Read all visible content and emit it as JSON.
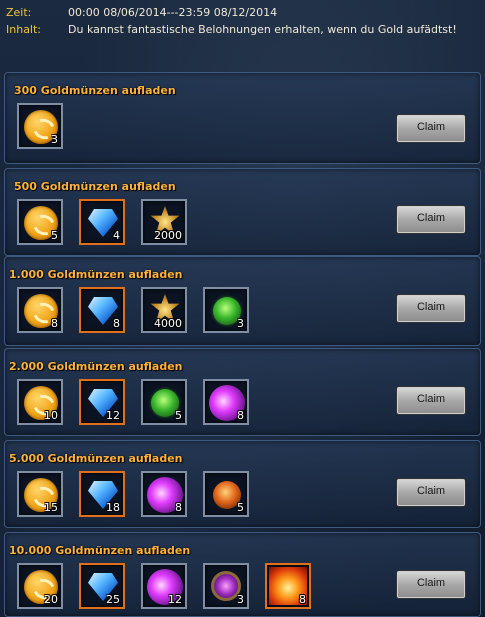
{
  "header": {
    "time_label": "Zeit:",
    "time_value": "00:00 08/06/2014---23:59 08/12/2014",
    "content_label": "Inhalt:",
    "content_value": "Du kannst fantastische Belohnungen erhalten, wenn du Gold aufädtst!"
  },
  "tiers": [
    {
      "title": "300 Goldmünzen aufladen",
      "claim_label": "Claim",
      "rewards": [
        {
          "icon": "gold-coin-icon",
          "qty": "3"
        }
      ]
    },
    {
      "title": "500 Goldmünzen aufladen",
      "claim_label": "Claim",
      "rewards": [
        {
          "icon": "gold-coin-icon",
          "qty": "5"
        },
        {
          "icon": "blue-diamond-icon",
          "qty": "4"
        },
        {
          "icon": "star-medal-icon",
          "qty": "2000"
        }
      ]
    },
    {
      "title": "1.000 Goldmünzen aufladen",
      "claim_label": "Claim",
      "rewards": [
        {
          "icon": "gold-coin-icon",
          "qty": "8"
        },
        {
          "icon": "blue-diamond-icon",
          "qty": "8"
        },
        {
          "icon": "star-medal-icon",
          "qty": "4000"
        },
        {
          "icon": "green-orb-icon",
          "qty": "3"
        }
      ]
    },
    {
      "title": "2.000 Goldmünzen aufladen",
      "claim_label": "Claim",
      "rewards": [
        {
          "icon": "gold-coin-icon",
          "qty": "10"
        },
        {
          "icon": "blue-diamond-icon",
          "qty": "12"
        },
        {
          "icon": "green-orb-icon",
          "qty": "5"
        },
        {
          "icon": "purple-orb-icon",
          "qty": "8"
        }
      ]
    },
    {
      "title": "5.000 Goldmünzen aufladen",
      "claim_label": "Claim",
      "rewards": [
        {
          "icon": "gold-coin-icon",
          "qty": "15"
        },
        {
          "icon": "blue-diamond-icon",
          "qty": "18"
        },
        {
          "icon": "purple-orb-icon",
          "qty": "8"
        },
        {
          "icon": "red-orb-icon",
          "qty": "5"
        }
      ]
    },
    {
      "title": "10.000 Goldmünzen aufladen",
      "claim_label": "Claim",
      "rewards": [
        {
          "icon": "gold-coin-icon",
          "qty": "20"
        },
        {
          "icon": "blue-diamond-icon",
          "qty": "25"
        },
        {
          "icon": "purple-orb-icon",
          "qty": "12"
        },
        {
          "icon": "amulet-icon",
          "qty": "3"
        },
        {
          "icon": "fire-emblem-icon",
          "qty": "8"
        }
      ]
    }
  ]
}
